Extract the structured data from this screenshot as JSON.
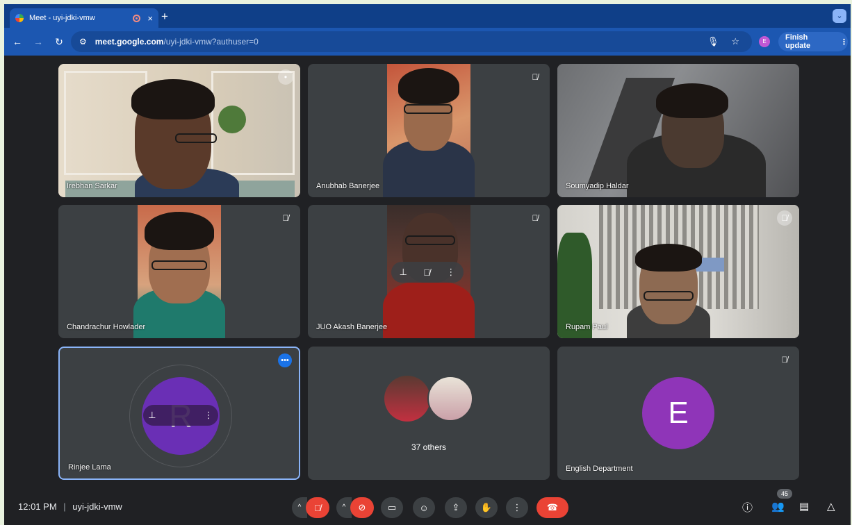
{
  "browser": {
    "tab_title": "Meet - uyi-jdki-vmw",
    "tab_close": "×",
    "new_tab": "+",
    "tab_menu": "⌄",
    "url_host": "meet.google.com",
    "url_path": "/uyi-jdki-vmw?authuser=0",
    "finish_update": "Finish update",
    "profile_initial": "E"
  },
  "participants": [
    {
      "name": "Irebhan Sarkar"
    },
    {
      "name": "Anubhab Banerjee"
    },
    {
      "name": "Soumyadip Haldar"
    },
    {
      "name": "Chandrachur Howlader"
    },
    {
      "name": "JUO Akash Banerjee"
    },
    {
      "name": "Rupam Paul"
    },
    {
      "name": "Rinjee Lama",
      "initial": "R"
    },
    {
      "name": "37 others"
    },
    {
      "name": "English Department",
      "initial": "E"
    }
  ],
  "status": {
    "time": "12:01 PM",
    "separator": "|",
    "meeting_code": "uyi-jdki-vmw",
    "participant_count": "45"
  },
  "colors": {
    "tile_bg": "#3c4043",
    "active_border": "#8ab4f8",
    "hangup_red": "#ea4335",
    "avatar_purple": "#6a2fb5",
    "avatar_violet": "#8f35b8"
  }
}
